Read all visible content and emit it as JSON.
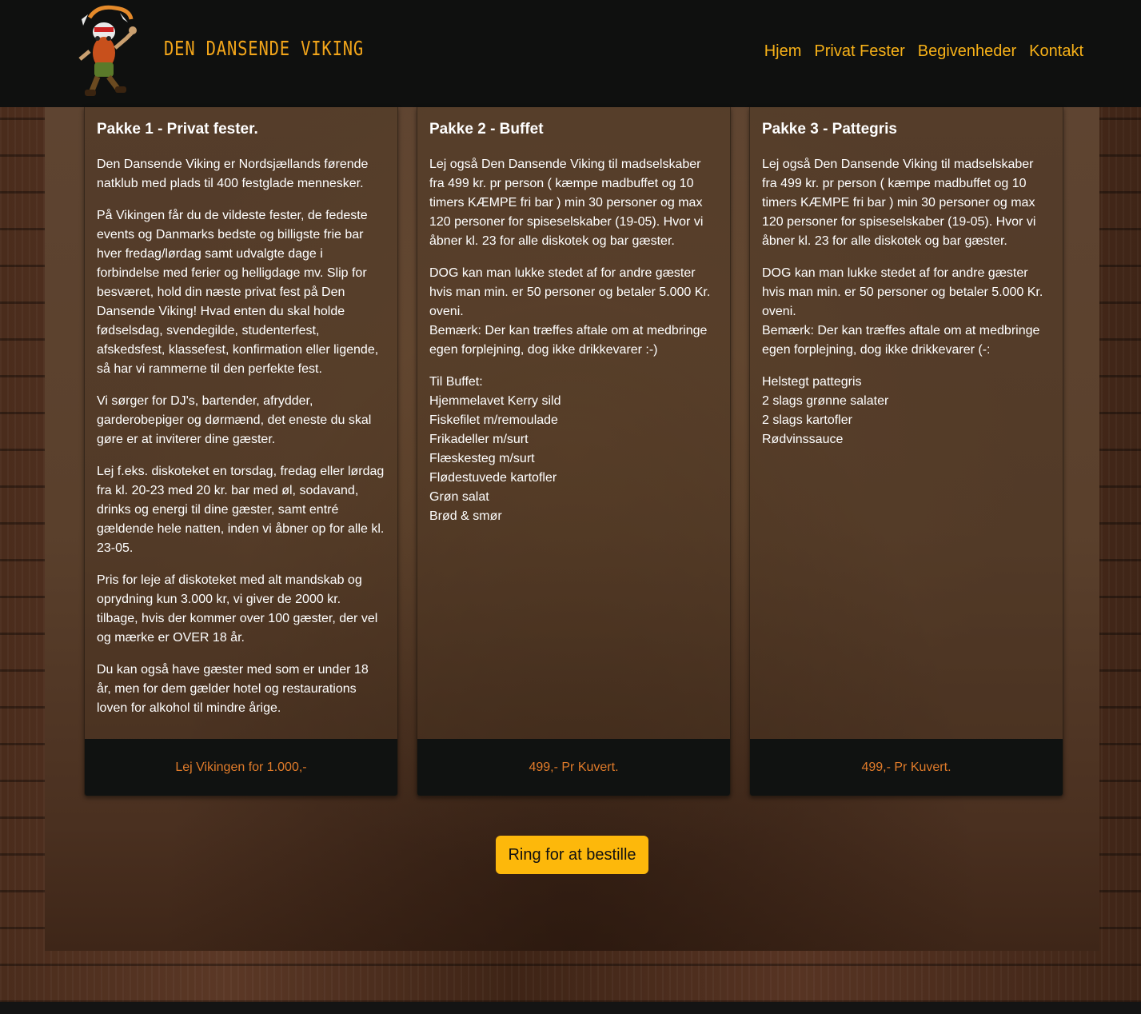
{
  "header": {
    "brand": "DEN DANSENDE VIKING",
    "nav": [
      "Hjem",
      "Privat Fester",
      "Begivenheder",
      "Kontakt"
    ]
  },
  "colors": {
    "accent": "#f7b118",
    "footer_text": "#e07b2a",
    "button": "#fdb80b",
    "header_bg": "#0f100f"
  },
  "cards": [
    {
      "title": "Pakke 1 - Privat fester.",
      "paragraphs": [
        "Den Dansende Viking er Nordsjællands førende natklub med plads til 400 festglade mennesker.",
        "På Vikingen får du de vildeste fester, de fedeste events og Danmarks bedste og billigste frie bar hver fredag/lørdag samt udvalgte dage i forbindelse med ferier og helligdage mv. Slip for besværet, hold din næste privat fest på Den Dansende Viking! Hvad enten du skal holde fødselsdag, svendegilde, studenterfest, afskedsfest, klassefest, konfirmation eller ligende, så har vi rammerne til den perfekte fest.",
        "Vi sørger for DJ's, bartender, afrydder, garderobepiger og dørmænd, det eneste du skal gøre er at inviterer dine gæster.",
        "Lej f.eks. diskoteket en torsdag, fredag eller lørdag fra kl. 20-23 med 20 kr. bar med øl, sodavand, drinks og energi til dine gæster, samt entré gældende hele natten, inden vi åbner op for alle kl. 23-05.",
        "Pris for leje af diskoteket med alt mandskab og oprydning kun 3.000 kr, vi giver de 2000 kr. tilbage, hvis der kommer over 100 gæster, der vel og mærke er OVER 18 år.",
        "Du kan også have gæster med som er under 18 år, men for dem gælder hotel og restaurations loven for alkohol til mindre årige."
      ],
      "footer": "Lej Vikingen for 1.000,-"
    },
    {
      "title": "Pakke 2 - Buffet",
      "paragraphs": [
        "Lej også Den Dansende Viking til madselskaber fra 499 kr. pr person ( kæmpe madbuffet og 10 timers KÆMPE fri bar ) min 30 personer og max 120 personer for spiseselskaber (19-05). Hvor vi åbner kl. 23 for alle diskotek og bar gæster.",
        "DOG kan man lukke stedet af for andre gæster hvis man min. er 50 personer og betaler 5.000 Kr. oveni.\nBemærk: Der kan træffes aftale om at medbringe egen forplejning, dog ikke drikkevarer :-)",
        "Til Buffet:\nHjemmelavet Kerry sild\nFiskefilet m/remoulade\nFrikadeller m/surt\nFlæskesteg m/surt\nFlødestuvede kartofler\nGrøn salat\nBrød & smør"
      ],
      "footer": "499,- Pr Kuvert."
    },
    {
      "title": "Pakke 3 - Pattegris",
      "paragraphs": [
        "Lej også Den Dansende Viking til madselskaber fra 499 kr. pr person ( kæmpe madbuffet og 10 timers KÆMPE fri bar ) min 30 personer og max 120 personer for spiseselskaber (19-05). Hvor vi åbner kl. 23 for alle diskotek og bar gæster.",
        "DOG kan man lukke stedet af for andre gæster hvis man min. er 50 personer og betaler 5.000 Kr. oveni.\nBemærk: Der kan træffes aftale om at medbringe egen forplejning, dog ikke drikkevarer (-:",
        "Helstegt pattegris\n2 slags grønne salater\n2 slags kartofler\nRødvinssauce"
      ],
      "footer": "499,- Pr Kuvert."
    }
  ],
  "cta": {
    "label": "Ring for at bestille"
  }
}
